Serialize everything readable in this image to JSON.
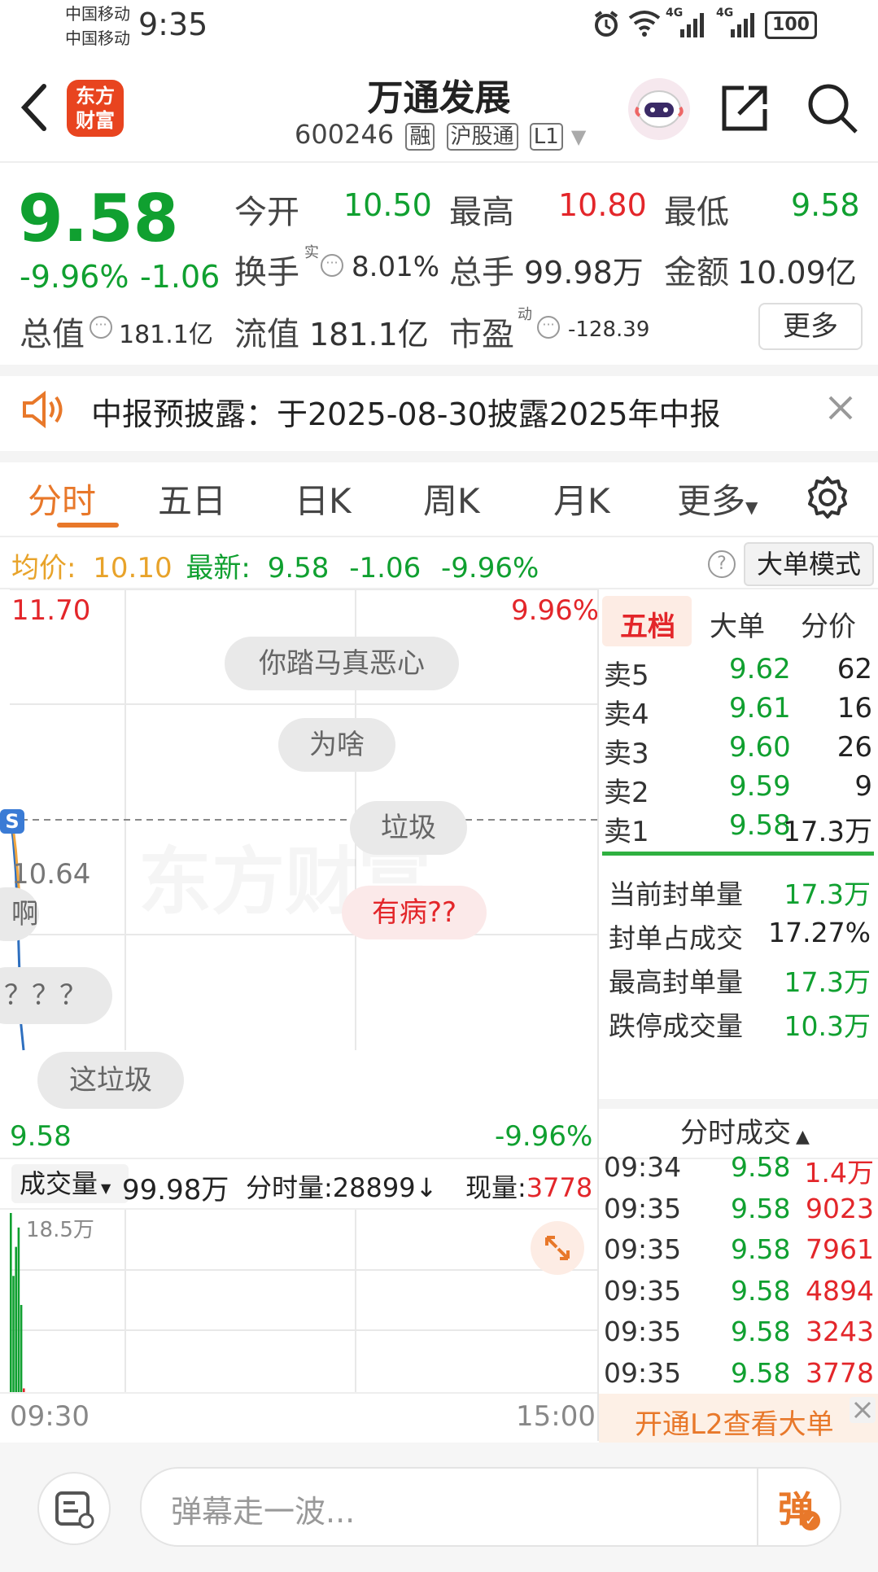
{
  "status": {
    "carrier1": "中国移动",
    "carrier2": "中国移动",
    "time": "9:35",
    "network1": "4G",
    "network2": "4G",
    "battery": "100"
  },
  "header": {
    "logo_text1": "东方",
    "logo_text2": "财富",
    "title": "万通发展",
    "code": "600246",
    "tag1": "融",
    "tag2": "沪股通",
    "tag3": "L1"
  },
  "quote": {
    "price": "9.58",
    "change_pct": "-9.96%",
    "change": "-1.06",
    "open_label": "今开",
    "open": "10.50",
    "high_label": "最高",
    "high": "10.80",
    "low_label": "最低",
    "low": "9.58",
    "turnover_label": "换手",
    "turnover_sup": "实",
    "turnover": "8.01%",
    "volume_label": "总手",
    "volume": "99.98万",
    "amount_label": "金额",
    "amount": "10.09亿",
    "mktcap_label": "总值",
    "mktcap": "181.1亿",
    "float_label": "流值",
    "float": "181.1亿",
    "pe_label": "市盈",
    "pe_sup": "动",
    "pe": "-128.39",
    "more_button": "更多"
  },
  "notice": {
    "text": "中报预披露：于2025-08-30披露2025年中报"
  },
  "tabs": [
    "分时",
    "五日",
    "日K",
    "周K",
    "月K",
    "更多"
  ],
  "tabs_selected": 0,
  "info_bar": {
    "avg_label": "均价:",
    "avg": "10.10",
    "latest_label": "最新:",
    "latest": "9.58",
    "chg": "-1.06",
    "pct": "-9.96%",
    "help": "?",
    "mode_button": "大单模式"
  },
  "chart": {
    "top_price": "11.70",
    "top_pct": "9.96%",
    "mid_price": "10.64",
    "bottom_price": "9.58",
    "bottom_pct": "-9.96%",
    "s_marker": "S",
    "danmaku": [
      "你踏马真恶心",
      "为啥",
      "垃圾",
      "有病??",
      "？？？",
      "这垃圾",
      "啊"
    ],
    "vol_label": "成交量",
    "vol_value": "99.98万",
    "time_vol_label": "分时量:",
    "time_vol": "28899",
    "cur_vol_label": "现量:",
    "cur_vol": "3778",
    "vol_max": "18.5万",
    "time_start": "09:30",
    "time_end": "15:00"
  },
  "chart_data": {
    "type": "line",
    "x": [
      "09:30",
      "09:31",
      "09:32",
      "09:33",
      "09:34",
      "09:35"
    ],
    "series": [
      {
        "values": [
          10.64,
          10.55,
          10.4,
          10.1,
          9.7,
          9.58
        ]
      },
      {
        "values": [
          10.64,
          10.6,
          10.5,
          10.35,
          10.2,
          10.1
        ]
      }
    ],
    "ylim": [
      9.58,
      11.7
    ],
    "volumes": [
      18.5,
      12,
      15,
      17,
      9,
      0.38
    ]
  },
  "orderbook": {
    "tabs": [
      "五档",
      "大单",
      "分价"
    ],
    "asks": [
      {
        "label": "卖5",
        "price": "9.62",
        "qty": "62"
      },
      {
        "label": "卖4",
        "price": "9.61",
        "qty": "16"
      },
      {
        "label": "卖3",
        "price": "9.60",
        "qty": "26"
      },
      {
        "label": "卖2",
        "price": "9.59",
        "qty": "9"
      },
      {
        "label": "卖1",
        "price": "9.58",
        "qty": "17.3万"
      }
    ],
    "stats": [
      {
        "label": "当前封单量",
        "value": "17.3万"
      },
      {
        "label": "封单占成交",
        "value": "17.27%"
      },
      {
        "label": "最高封单量",
        "value": "17.3万"
      },
      {
        "label": "跌停成交量",
        "value": "10.3万"
      }
    ],
    "ticks_title": "分时成交",
    "ticks": [
      {
        "time": "09:34",
        "price": "9.58",
        "vol": "1.4万"
      },
      {
        "time": "09:35",
        "price": "9.58",
        "vol": "9023"
      },
      {
        "time": "09:35",
        "price": "9.58",
        "vol": "7961"
      },
      {
        "time": "09:35",
        "price": "9.58",
        "vol": "4894"
      },
      {
        "time": "09:35",
        "price": "9.58",
        "vol": "3243"
      },
      {
        "time": "09:35",
        "price": "9.58",
        "vol": "3778"
      }
    ],
    "l2_banner": "开通L2查看大单"
  },
  "bottom": {
    "input_placeholder": "弹幕走一波...",
    "danmaku_button": "弹"
  },
  "colors": {
    "up": "#e3262a",
    "down": "#10a030",
    "accent": "#e8782a"
  }
}
